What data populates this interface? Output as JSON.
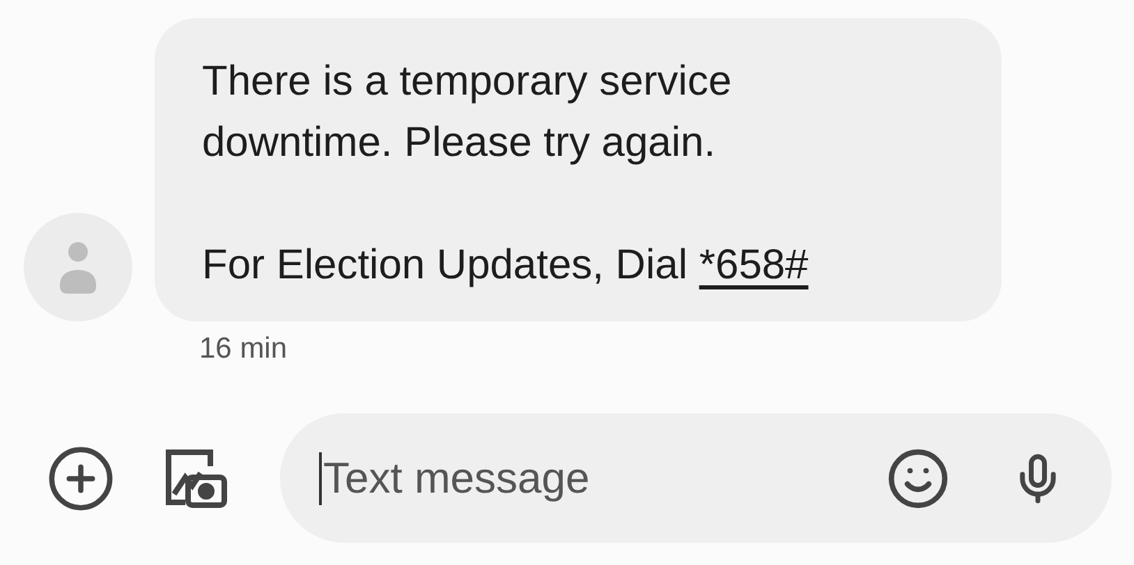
{
  "message": {
    "text": "There is a temporary service downtime. Please try again.",
    "footer": "For Election Updates, Dial ",
    "link": "*658#",
    "time": "16 min"
  },
  "composer": {
    "placeholder": "Text message"
  }
}
